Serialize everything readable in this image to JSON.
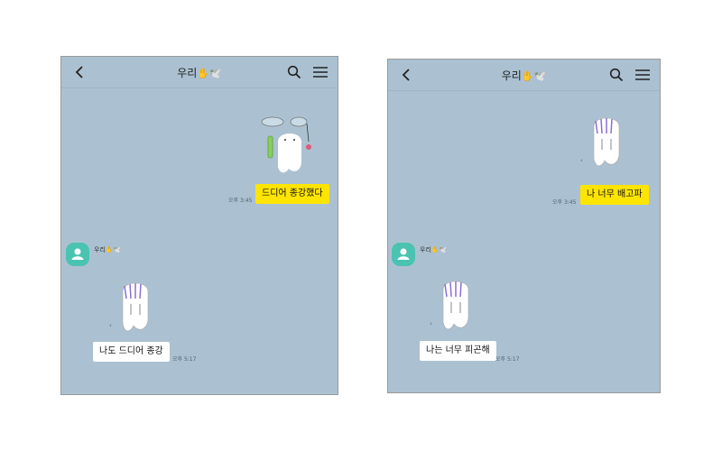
{
  "chat_left": {
    "title": "우리",
    "title_emojis": "✋🕊️",
    "sent": {
      "text": "드디어 종강했다",
      "time": "오후 3:45"
    },
    "sender_name": "우리",
    "sender_emojis": "✋🕊️",
    "received": {
      "text": "나도 드디어 종강",
      "time": "오후 5:17"
    }
  },
  "chat_right": {
    "title": "우리",
    "title_emojis": "✋🕊️",
    "sent": {
      "text": "나 너무 배고파",
      "time": "오후 3:45"
    },
    "sender_name": "우리",
    "sender_emojis": "✋🕊️",
    "received": {
      "text": "나는 너무 피곤해",
      "time": "오후 5:17"
    }
  },
  "colors": {
    "chat_background": "#abc1d1",
    "sent_bubble": "#fee500",
    "received_bubble": "#ffffff",
    "avatar": "#4bc3b1"
  },
  "icons": [
    "back-icon",
    "search-icon",
    "menu-icon",
    "avatar-person-icon",
    "ghost-sticker"
  ]
}
